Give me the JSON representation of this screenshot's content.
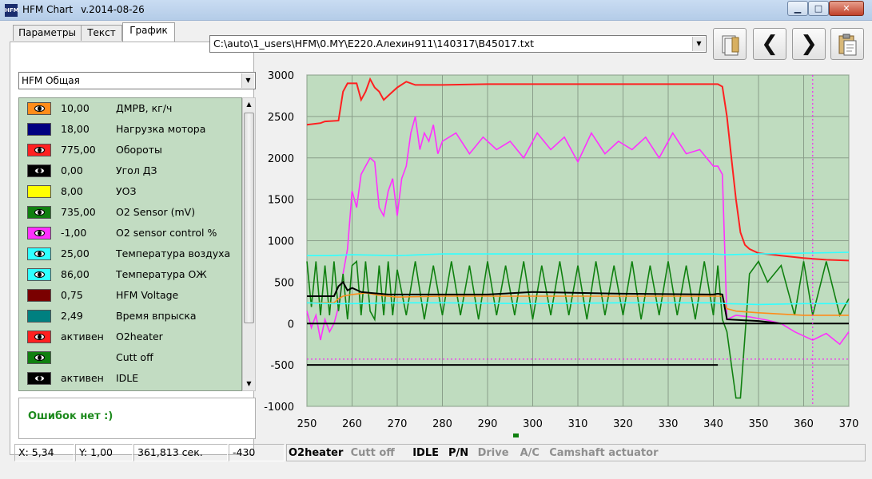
{
  "window": {
    "title": "HFM Chart",
    "version": "v.2014-08-26",
    "icon": "HFM"
  },
  "tabs": [
    {
      "label": "Параметры"
    },
    {
      "label": "Текст"
    },
    {
      "label": "График"
    }
  ],
  "file_path": "C:\\auto\\1_users\\HFM\\0.MY\\E220.Алехин911\\140317\\B45017.txt",
  "preset": "HFM Общая",
  "params": [
    {
      "value": "10,00",
      "name": "ДМРВ, кг/ч",
      "color": "#ff8c1a",
      "visible": true
    },
    {
      "value": "18,00",
      "name": "Нагрузка мотора",
      "color": "#000080",
      "visible": false
    },
    {
      "value": "775,00",
      "name": "Обороты",
      "color": "#ff2020",
      "visible": true
    },
    {
      "value": "0,00",
      "name": "Угол ДЗ",
      "color": "#000000",
      "visible": true
    },
    {
      "value": "8,00",
      "name": "УОЗ",
      "color": "#ffff00",
      "visible": false
    },
    {
      "value": "735,00",
      "name": "O2 Sensor (mV)",
      "color": "#108010",
      "visible": true
    },
    {
      "value": "-1,00",
      "name": "O2 sensor control %",
      "color": "#ff30ff",
      "visible": true
    },
    {
      "value": "25,00",
      "name": "Температура воздуха",
      "color": "#30ffff",
      "visible": true
    },
    {
      "value": "86,00",
      "name": "Температура ОЖ",
      "color": "#30ffff",
      "visible": true
    },
    {
      "value": "0,75",
      "name": "HFM Voltage",
      "color": "#7a0000",
      "visible": false
    },
    {
      "value": "2,49",
      "name": "Время впрыска",
      "color": "#008080",
      "visible": false
    },
    {
      "value": "активен",
      "name": "O2heater",
      "color": "#ff2020",
      "visible": true
    },
    {
      "value": "",
      "name": "Cutt off",
      "color": "#108010",
      "visible": true
    },
    {
      "value": "активен",
      "name": "IDLE",
      "color": "#000000",
      "visible": true
    }
  ],
  "errors_text": "Ошибок нет :)",
  "status": {
    "x": "X: 5,34",
    "y": "Y: 1,00",
    "time": "361,813 сек.",
    "cursor_value": "-430",
    "flags": [
      {
        "label": "O2heater",
        "active": true
      },
      {
        "label": "Cutt off",
        "active": false
      },
      {
        "label": "IDLE",
        "active": true
      },
      {
        "label": "P/N",
        "active": true
      },
      {
        "label": "Drive",
        "active": false
      },
      {
        "label": "A/C",
        "active": false
      },
      {
        "label": "Camshaft actuator",
        "active": false
      }
    ]
  },
  "chart_data": {
    "type": "line",
    "xlim": [
      250,
      370
    ],
    "ylim": [
      -1000,
      3000
    ],
    "x_ticks": [
      250,
      260,
      270,
      280,
      290,
      300,
      310,
      320,
      330,
      340,
      350,
      360,
      370
    ],
    "y_ticks": [
      3000,
      2500,
      2000,
      1500,
      1000,
      500,
      0,
      -500,
      -1000
    ],
    "grid": true,
    "background": "#bfdcbf",
    "cursor_x": 362,
    "cursor_y": -430,
    "series": [
      {
        "name": "Обороты",
        "color": "#ff2020",
        "x": [
          250,
          253,
          254,
          257,
          258,
          259,
          261,
          262,
          263,
          264,
          265,
          266,
          267,
          268,
          270,
          272,
          274,
          280,
          290,
          300,
          310,
          320,
          330,
          340,
          341,
          342,
          343,
          344,
          345,
          346,
          347,
          348,
          350,
          355,
          360,
          365,
          370
        ],
        "y": [
          2400,
          2420,
          2440,
          2450,
          2800,
          2900,
          2900,
          2700,
          2800,
          2950,
          2850,
          2800,
          2700,
          2750,
          2850,
          2920,
          2880,
          2880,
          2890,
          2890,
          2890,
          2890,
          2890,
          2890,
          2890,
          2860,
          2500,
          2000,
          1500,
          1100,
          950,
          900,
          850,
          820,
          790,
          770,
          760
        ]
      },
      {
        "name": "O2 sensor control %",
        "color": "#ff30ff",
        "x": [
          250,
          251,
          252,
          253,
          254,
          255,
          256,
          257,
          258,
          259,
          260,
          261,
          262,
          263,
          264,
          265,
          266,
          267,
          268,
          269,
          270,
          271,
          272,
          273,
          274,
          275,
          276,
          277,
          278,
          279,
          280,
          283,
          286,
          289,
          292,
          295,
          298,
          301,
          304,
          307,
          310,
          313,
          316,
          319,
          322,
          325,
          328,
          331,
          334,
          337,
          340,
          341,
          342,
          343,
          345,
          348,
          350,
          352,
          355,
          358,
          360,
          362,
          365,
          368,
          370
        ],
        "y": [
          150,
          -50,
          100,
          -200,
          50,
          -100,
          0,
          200,
          600,
          900,
          1600,
          1400,
          1800,
          1900,
          2000,
          1950,
          1400,
          1300,
          1600,
          1750,
          1300,
          1750,
          1900,
          2300,
          2500,
          2100,
          2300,
          2200,
          2400,
          2050,
          2200,
          2300,
          2050,
          2250,
          2100,
          2200,
          2000,
          2300,
          2100,
          2250,
          1950,
          2300,
          2050,
          2200,
          2100,
          2250,
          2000,
          2300,
          2050,
          2100,
          1900,
          1900,
          1800,
          50,
          100,
          80,
          60,
          40,
          0,
          -100,
          -150,
          -200,
          -120,
          -250,
          -100
        ]
      },
      {
        "name": "O2 Sensor (mV)",
        "color": "#108010",
        "x": [
          250,
          251,
          252,
          253,
          254,
          255,
          256,
          257,
          258,
          259,
          260,
          261,
          262,
          263,
          264,
          265,
          266,
          267,
          268,
          269,
          270,
          272,
          274,
          276,
          278,
          280,
          282,
          284,
          286,
          288,
          290,
          292,
          294,
          296,
          298,
          300,
          302,
          304,
          306,
          308,
          310,
          312,
          314,
          316,
          318,
          320,
          322,
          324,
          326,
          328,
          330,
          332,
          334,
          336,
          338,
          340,
          341,
          342,
          343,
          344,
          345,
          346,
          348,
          350,
          352,
          355,
          358,
          360,
          362,
          365,
          368,
          370
        ],
        "y": [
          750,
          200,
          750,
          100,
          700,
          100,
          750,
          150,
          600,
          50,
          700,
          750,
          100,
          750,
          150,
          50,
          700,
          100,
          750,
          100,
          650,
          100,
          750,
          50,
          700,
          100,
          750,
          100,
          700,
          50,
          750,
          100,
          700,
          100,
          750,
          50,
          700,
          100,
          750,
          100,
          700,
          50,
          750,
          100,
          700,
          100,
          750,
          50,
          700,
          100,
          750,
          100,
          700,
          50,
          750,
          100,
          700,
          50,
          -100,
          -500,
          -900,
          -900,
          600,
          750,
          500,
          700,
          100,
          750,
          100,
          750,
          100,
          300
        ]
      },
      {
        "name": "ДМРВ, кг/ч",
        "color": "#ff8c1a",
        "x": [
          250,
          256,
          257,
          258,
          260,
          263,
          266,
          270,
          280,
          290,
          300,
          310,
          320,
          330,
          340,
          341,
          342,
          343,
          345,
          350,
          360,
          370
        ],
        "y": [
          250,
          250,
          300,
          330,
          350,
          370,
          340,
          320,
          330,
          330,
          330,
          330,
          330,
          330,
          330,
          330,
          330,
          180,
          150,
          130,
          100,
          100
        ]
      },
      {
        "name": "Угол ДЗ",
        "color": "#000000",
        "x": [
          250,
          256,
          257,
          258,
          259,
          260,
          262,
          264,
          266,
          268,
          270,
          290,
          300,
          320,
          340,
          341,
          342,
          343,
          350,
          355
        ],
        "y": [
          330,
          330,
          450,
          500,
          400,
          430,
          380,
          370,
          360,
          350,
          350,
          350,
          380,
          360,
          350,
          360,
          350,
          50,
          30,
          0
        ]
      },
      {
        "name": "Температура воздуха",
        "color": "#30ffff",
        "x": [
          250,
          255,
          260,
          270,
          280,
          300,
          320,
          340,
          343,
          350,
          360,
          370
        ],
        "y": [
          250,
          240,
          240,
          250,
          250,
          240,
          250,
          250,
          240,
          230,
          240,
          240
        ]
      },
      {
        "name": "Температура ОЖ",
        "color": "#30ffff",
        "x": [
          250,
          255,
          260,
          270,
          280,
          300,
          320,
          340,
          343,
          350,
          360,
          370
        ],
        "y": [
          820,
          820,
          830,
          820,
          840,
          840,
          840,
          840,
          830,
          840,
          850,
          860
        ]
      },
      {
        "name": "IDLE",
        "color": "#000000",
        "x": [
          250,
          342,
          370
        ],
        "y": [
          0,
          0,
          0
        ]
      },
      {
        "name": "O2heater",
        "color": "#000000",
        "x": [
          250,
          341
        ],
        "y": [
          -500,
          -500
        ]
      }
    ]
  }
}
